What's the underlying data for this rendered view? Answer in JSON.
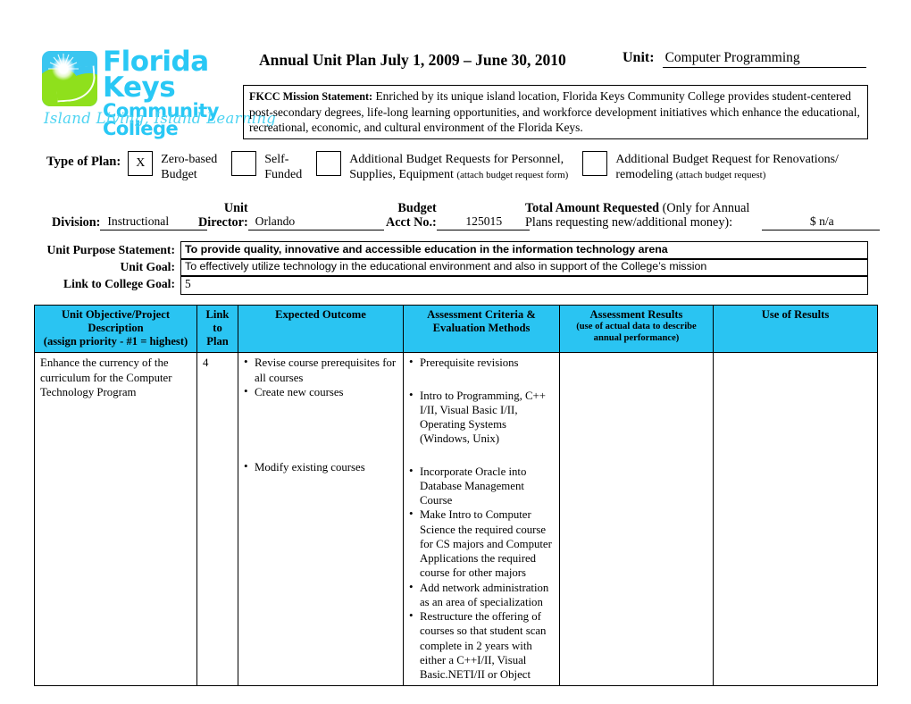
{
  "header": {
    "logo": {
      "line1": "Florida Keys",
      "line2": "Community College",
      "tagline": "Island Living, Island Learning",
      "mark_bg": "#3ac6f0",
      "mark_hill": "#8fe01c",
      "text_color": "#29c8f5"
    },
    "title": "Annual Unit Plan July 1, 2009 – June 30, 2010",
    "unit_label": "Unit:",
    "unit_value": "Computer Programming",
    "mission_label": "FKCC Mission Statement:",
    "mission_text": " Enriched by its unique island location, Florida Keys Community College provides student-centered post-secondary degrees, life-long learning opportunities, and workforce development initiatives which enhance the educational, recreational, economic, and cultural environment of the Florida Keys."
  },
  "plan": {
    "label": "Type of Plan:",
    "options": [
      {
        "checked": "X",
        "line1": "Zero-based",
        "line2": "Budget",
        "note": ""
      },
      {
        "checked": "",
        "line1": "Self-",
        "line2": "Funded",
        "note": ""
      },
      {
        "checked": "",
        "line1": "Additional Budget Requests for Personnel,",
        "line2": "Supplies, Equipment ",
        "note": "(attach budget request form)"
      },
      {
        "checked": "",
        "line1": "Additional Budget Request for Renovations/",
        "line2": "remodeling ",
        "note": "(attach budget request)"
      }
    ]
  },
  "fields": {
    "division_label": "Division:",
    "division_value": "Instructional",
    "director_label_1": "Unit",
    "director_label_2": "Director:",
    "director_value": "Orlando",
    "acct_label_1": "Budget",
    "acct_label_2": "Acct No.:",
    "acct_value": "125015",
    "total_label_bold": "Total Amount Requested",
    "total_label_rest": " (Only for Annual",
    "total_label_line2": "Plans requesting new/additional money):",
    "total_value": "$ n/a"
  },
  "purpose": {
    "purpose_label": "Unit Purpose Statement:",
    "purpose_value": "To provide quality, innovative and accessible education in the information technology arena",
    "goal_label": "Unit Goal:",
    "goal_value": "To effectively utilize technology in the educational environment and also in support of the College’s mission",
    "link_label": "Link to College Goal:",
    "link_value": "5"
  },
  "table": {
    "header_bg": "#2ac4f2",
    "columns": [
      {
        "line1": "Unit Objective/Project",
        "line2": "Description",
        "line3": "(assign priority - #1 = highest)"
      },
      {
        "line1": "Link",
        "line2": "to",
        "line3": "Plan"
      },
      {
        "line1": "Expected Outcome",
        "line2": "",
        "line3": ""
      },
      {
        "line1": "Assessment Criteria &",
        "line2": "Evaluation Methods",
        "line3": ""
      },
      {
        "line1": "Assessment Results",
        "line2": "(use of actual data to describe",
        "line3": "annual performance)"
      },
      {
        "line1": "Use of Results",
        "line2": "",
        "line3": ""
      }
    ],
    "rows": [
      {
        "objective": "Enhance the currency of the curriculum for the Computer Technology Program",
        "link": "4",
        "expected_outcome": [
          {
            "text": "Revise course prerequisites for all courses",
            "gap": "none"
          },
          {
            "text": "Create new courses",
            "gap": "none"
          },
          {
            "text": "Modify existing courses",
            "gap": "large"
          }
        ],
        "assessment_criteria": [
          {
            "text": "Prerequisite revisions",
            "gap": "none"
          },
          {
            "text": "Intro to Programming, C++ I/II, Visual Basic I/II, Operating Systems (Windows, Unix)",
            "gap": "small"
          },
          {
            "text": "Incorporate Oracle into Database Management Course",
            "gap": "small"
          },
          {
            "text": "Make Intro to Computer Science the required course for CS majors and Computer Applications the required course for other majors",
            "gap": "none"
          },
          {
            "text": "Add network administration as an area of specialization",
            "gap": "none"
          },
          {
            "text": "Restructure the offering of courses so that student scan complete in 2 years with either a C++I/II, Visual Basic.NETI/II or Object",
            "gap": "none"
          }
        ],
        "assessment_results": "",
        "use_of_results": ""
      }
    ]
  }
}
